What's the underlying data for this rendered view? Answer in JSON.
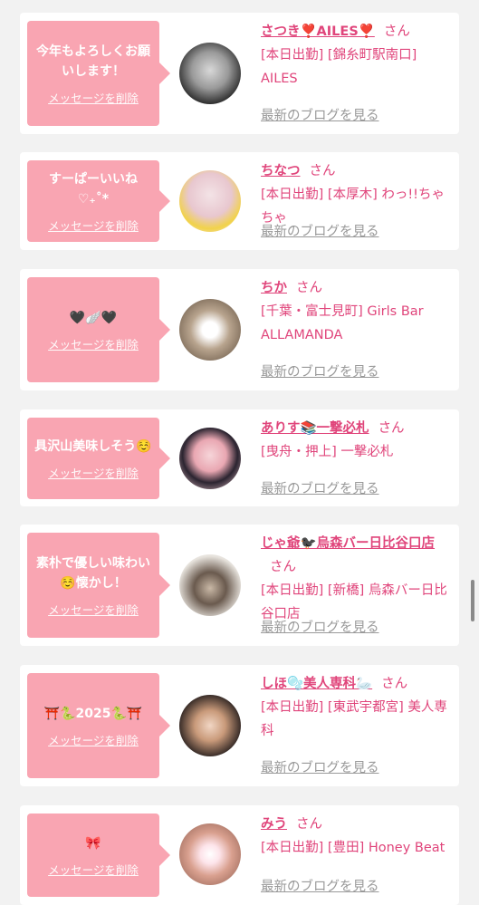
{
  "colors": {
    "accent": "#e0457b",
    "bubble": "#f9a5b2",
    "muted": "#999999"
  },
  "delete_label": "メッセージを削除",
  "blog_label": "最新のブログを見る",
  "san_label": "さん",
  "entries": [
    {
      "message": "今年もよろしくお願いします！",
      "name": "さつき❣️AILES❣️",
      "info": "[本日出勤] [錦糸町駅南口] AILES"
    },
    {
      "message": "すーぱーいいね ♡₊˚*",
      "name": "ちなつ",
      "info": "[本日出勤] [本厚木] わっ!!ちゃちゃ"
    },
    {
      "message": "🖤🪽🖤",
      "name": "ちか",
      "info": "[千葉・富士見町] Girls Bar ALLAMANDA"
    },
    {
      "message": "具沢山美味しそう☺️",
      "name": "ありす📚一撃必札",
      "info": "[曳舟・押上] 一撃必札"
    },
    {
      "message": "素朴で優しい味わい☺️懐かし！",
      "name": "じゃ爺🐦‍⬛烏森バー日比谷口店",
      "info": "[本日出勤] [新橋] 烏森バー日比谷口店"
    },
    {
      "message": "⛩️🐍2025🐍⛩️",
      "name": "しほ🫧美人専科🦢",
      "info": "[本日出勤] [東武宇都宮] 美人専科"
    },
    {
      "message": "🎀",
      "name": "みう",
      "info": "[本日出勤] [豊田] Honey Beat"
    }
  ]
}
